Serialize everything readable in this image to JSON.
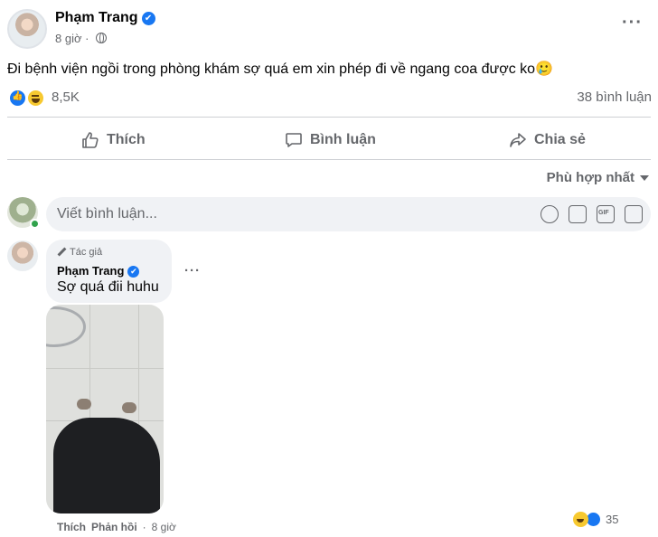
{
  "post": {
    "author": "Phạm Trang",
    "verified_mark": "✔",
    "time": "8 giờ",
    "text": "Đi bệnh viện ngồi trong phòng khám sợ quá em xin phép đi về ngang coa được ko🥲",
    "reaction_count": "8,5K",
    "comment_count": "38 bình luận"
  },
  "actions": {
    "like": "Thích",
    "comment": "Bình luận",
    "share": "Chia sẻ"
  },
  "sort": {
    "label": "Phù hợp nhất"
  },
  "composer": {
    "placeholder": "Viết bình luận..."
  },
  "comment": {
    "author_tag": "Tác giả",
    "author": "Phạm Trang",
    "text": "Sợ quá đii huhu",
    "like_label": "Thích",
    "reply_label": "Phản hồi",
    "time": "8 giờ",
    "reaction_count": "35"
  },
  "icons": {
    "gif_text": "GIF"
  },
  "colors": {
    "accent": "#1877f2",
    "muted": "#65676b",
    "bubble": "#f0f2f5"
  }
}
